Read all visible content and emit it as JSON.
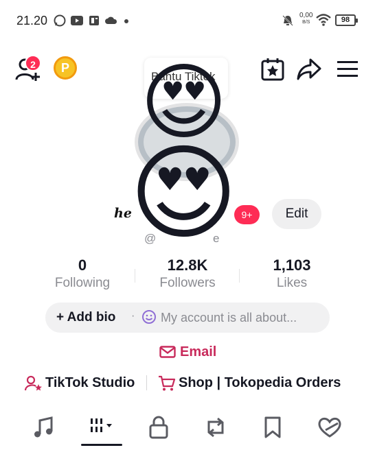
{
  "status_bar": {
    "time": "21.20",
    "net_speed_value": "0,00",
    "net_speed_unit": "B/S",
    "battery": "98"
  },
  "header": {
    "friends_badge": "2",
    "coin_letter": "P"
  },
  "profile": {
    "bubble_text": "Bantu Tiktok",
    "display_name": "he",
    "notification_count": "9+",
    "edit_label": "Edit",
    "username": "@",
    "username_suffix": "e",
    "emoji_top": "😍",
    "emoji_bottom": "😍"
  },
  "stats": [
    {
      "value": "0",
      "label": "Following"
    },
    {
      "value": "12.8K",
      "label": "Followers"
    },
    {
      "value": "1,103",
      "label": "Likes"
    }
  ],
  "bio": {
    "add_label": "+ Add bio",
    "separator": "·",
    "placeholder": "My account is all about..."
  },
  "email": {
    "label": "Email"
  },
  "links": {
    "studio": "TikTok Studio",
    "shop": "Shop | Tokopedia Orders"
  },
  "colors": {
    "accent_pink": "#fe2c55",
    "email_pink": "#c82a5b",
    "coin_gold": "#f7c325"
  }
}
